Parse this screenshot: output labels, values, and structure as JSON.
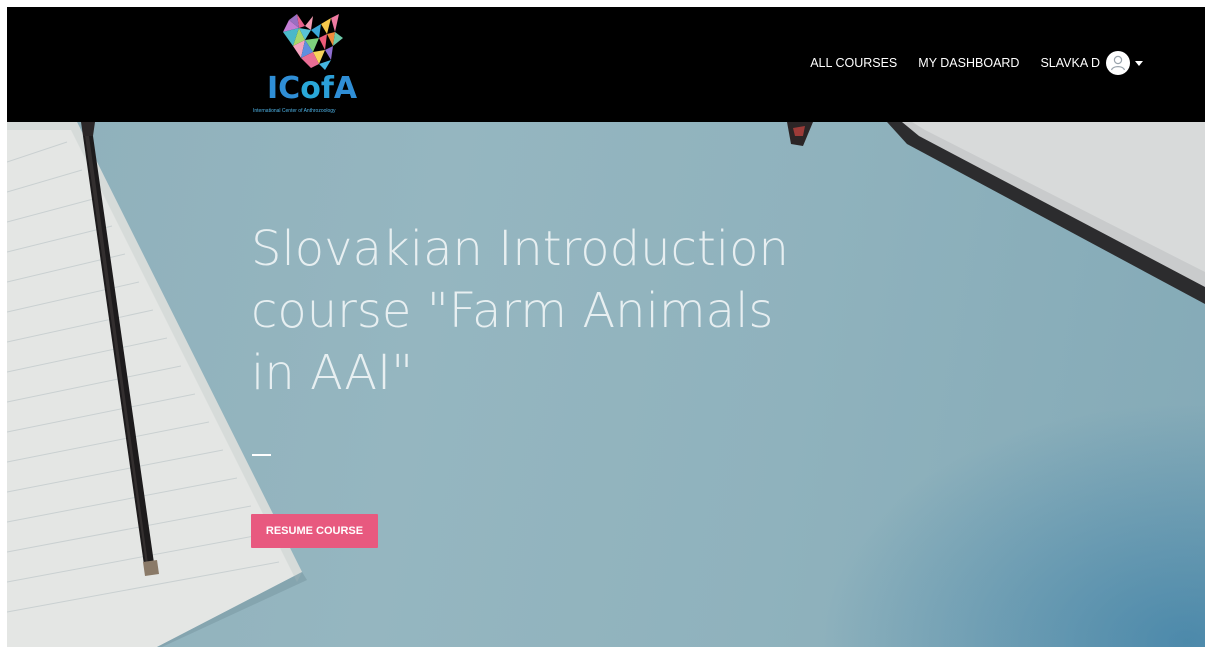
{
  "brand": {
    "logo_text": [
      "I",
      "C",
      "o",
      "f",
      "A"
    ],
    "tagline": "International Center of Anthrozoology",
    "colors": {
      "logo_blue": "#2f8ed6",
      "header_bg": "#000000"
    }
  },
  "nav": {
    "links": [
      {
        "label": "ALL COURSES"
      },
      {
        "label": "MY DASHBOARD"
      }
    ],
    "user": {
      "name": "SLAVKA D",
      "avatar_icon": "user-avatar-icon",
      "caret_icon": "caret-down-icon"
    }
  },
  "hero": {
    "title_lines": [
      "Slovakian Introduction",
      "course \"Farm Animals",
      "in AAI\""
    ],
    "resume_label": "RESUME COURSE",
    "colors": {
      "button": "#e8597f",
      "title": "#ffffff"
    }
  }
}
